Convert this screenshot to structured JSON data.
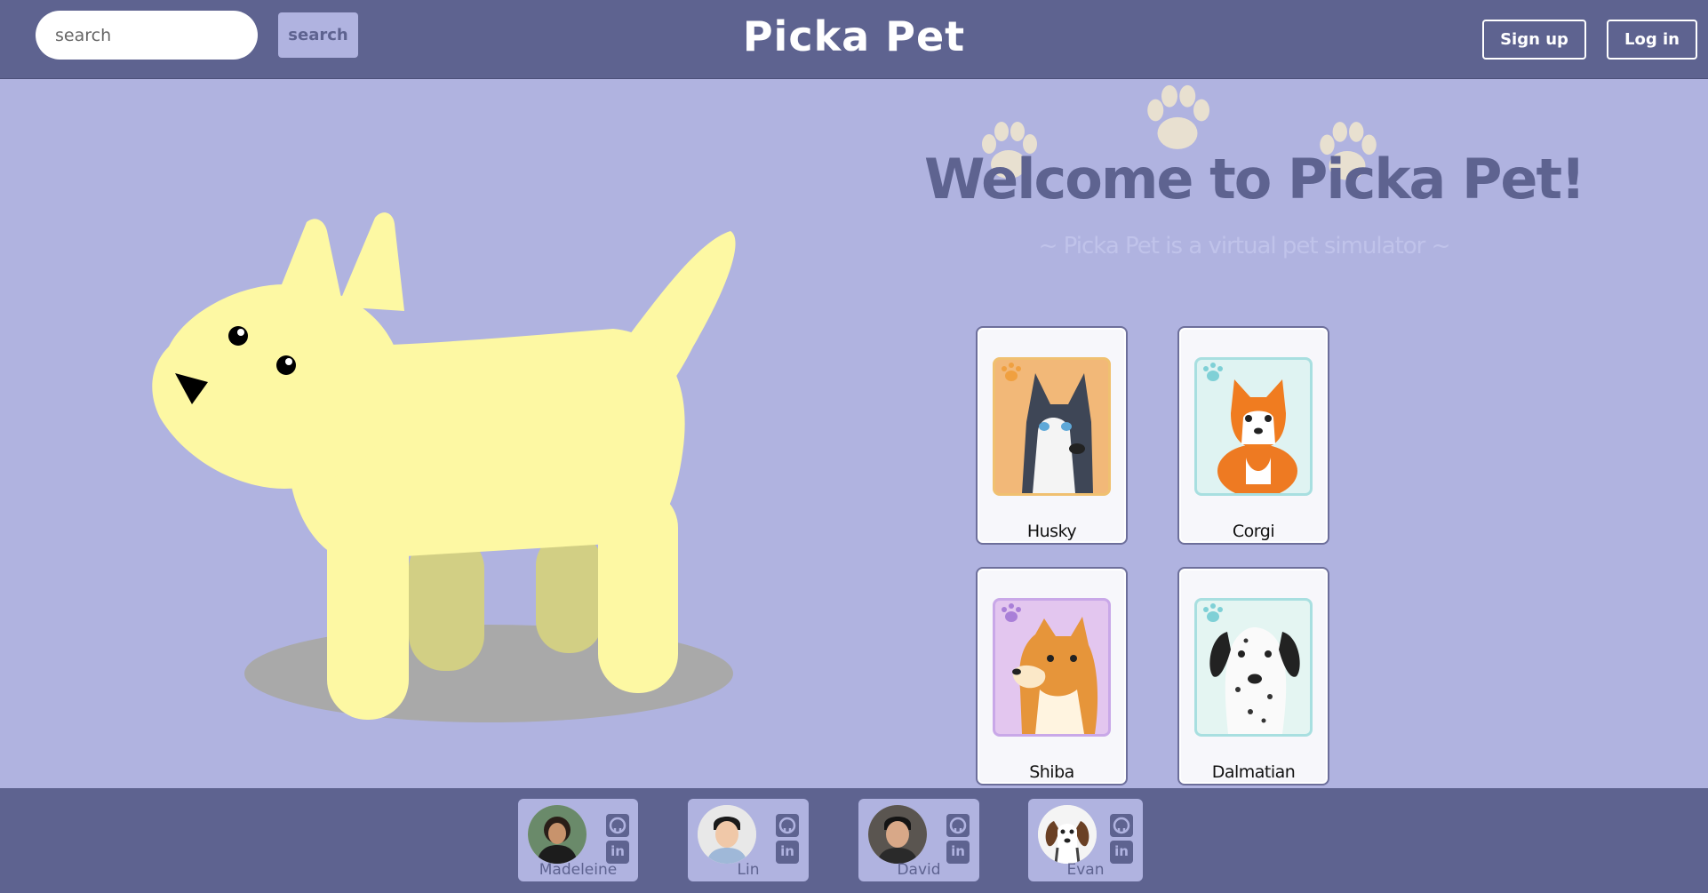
{
  "header": {
    "search_placeholder": "search",
    "search_button": "search",
    "brand": "Picka Pet",
    "signup_label": "Sign up",
    "login_label": "Log in"
  },
  "welcome": {
    "title": "Welcome to Picka Pet!",
    "subtitle": "~ Picka Pet is a virtual pet simulator ~"
  },
  "pets": [
    {
      "name": "Husky",
      "frame_color": "#f0c070",
      "paw_color": "#f0a040",
      "bg_color": "#f2b878",
      "icon": "husky-icon"
    },
    {
      "name": "Corgi",
      "frame_color": "#a8dfe0",
      "paw_color": "#7fd0d6",
      "bg_color": "#dff3f2",
      "icon": "corgi-icon"
    },
    {
      "name": "Shiba",
      "frame_color": "#c9a8e8",
      "paw_color": "#a97fd8",
      "bg_color": "#e3c6ef",
      "icon": "shiba-icon"
    },
    {
      "name": "Dalmatian",
      "frame_color": "#a8dfe0",
      "paw_color": "#7fd0d6",
      "bg_color": "#e4f5f2",
      "icon": "dalmatian-icon"
    }
  ],
  "developers": [
    {
      "name": "Madeleine"
    },
    {
      "name": "Lin"
    },
    {
      "name": "David"
    },
    {
      "name": "Evan"
    }
  ],
  "colors": {
    "header_bg": "#5e6390",
    "page_bg": "#b0b3e0",
    "dog_body": "#fdf8a3",
    "dog_shadow": "#a9a9a9",
    "paw_print": "#e8e0d0"
  }
}
